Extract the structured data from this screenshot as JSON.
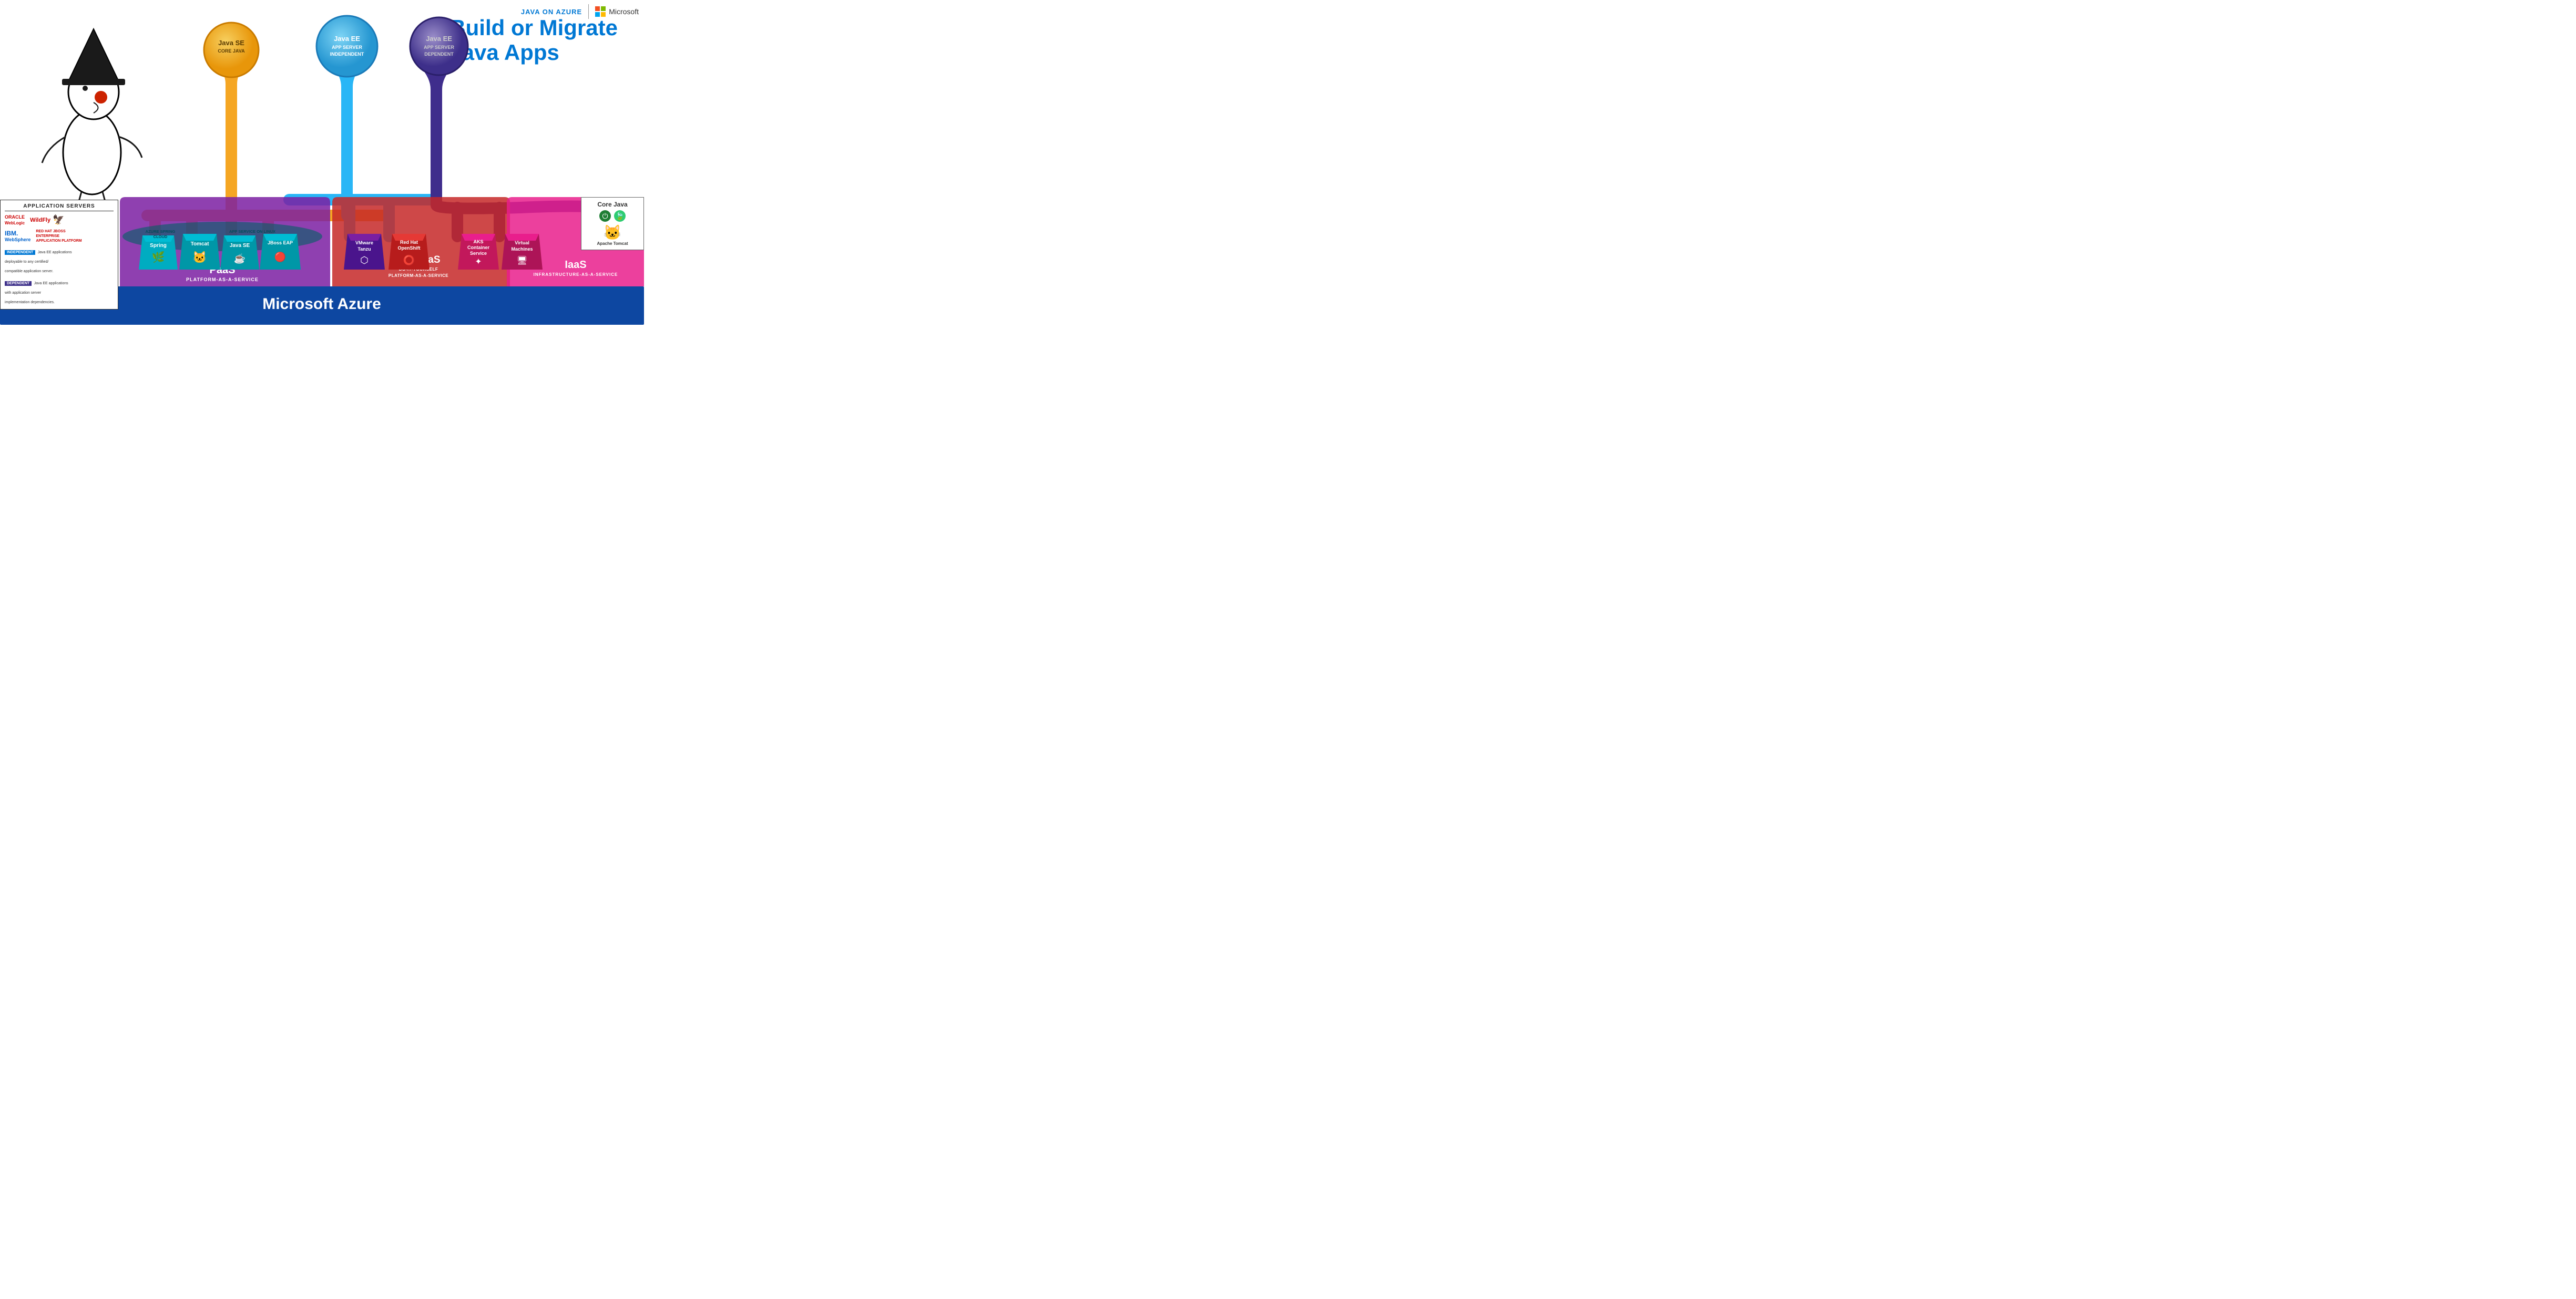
{
  "header": {
    "java_on_azure": "JAVA ON AZURE",
    "microsoft": "Microsoft"
  },
  "hero": {
    "line1": "Build or Migrate",
    "line2": "Java Apps"
  },
  "circles": {
    "java_se": {
      "title": "Java SE",
      "subtitle": "CORE JAVA"
    },
    "java_ee_ind": {
      "title": "Java EE",
      "sub1": "APP SERVER",
      "sub2": "INDEPENDENT"
    },
    "java_ee_dep": {
      "title": "Java EE",
      "sub1": "APP SERVER",
      "sub2": "DEPENDENT"
    }
  },
  "cups": [
    {
      "name": "Spring",
      "icon": "🍃"
    },
    {
      "name": "Tomcat",
      "icon": "🐱"
    },
    {
      "name": "Java SE",
      "icon": "☕"
    },
    {
      "name": "JBoss EAP",
      "icon": "🔴"
    },
    {
      "name": "VMware\nTanzu",
      "icon": "⬡"
    },
    {
      "name": "Red Hat\nOpenShift",
      "icon": "⭕"
    },
    {
      "name": "AKS\nContainer\nService",
      "icon": "✦"
    },
    {
      "name": "Virtual\nMachines",
      "icon": "🖥"
    }
  ],
  "sections": {
    "paas": {
      "title": "PaaS",
      "subtitle": "PLATFORM-AS-A-SERVICE",
      "sublabel1": "AZURE  SPRING",
      "sublabel2": "CLOUD",
      "sublabel3": "APP SERVICE ON LINUX"
    },
    "diy": {
      "title": "DIY PaaS",
      "sub1": "DO-IT-YOURSELF",
      "sub2": "PLATFORM-AS-A-SERVICE"
    },
    "iaas": {
      "title": "IaaS",
      "subtitle": "INFRASTRUCTURE-AS-A-SERVICE"
    },
    "azure": {
      "title": "Microsoft Azure"
    }
  },
  "app_servers": {
    "title": "APPLICATION SERVERS",
    "oracle_line1": "ORACLE",
    "oracle_line2": "WebLogic",
    "wildfly": "WildFly",
    "ibm_line1": "IBM.",
    "ibm_line2": "WebSphere",
    "redhat": "RED HAT JBOSS\nENTERPRISE\nAPPLICATION PLATFORM",
    "independent_badge": "INDEPENDENT",
    "independent_text": "Java EE applications\ndeployable to any certified/\ncompatible application server.",
    "dependent_badge": "DEPENDENT",
    "dependent_text": "Java EE applications\nwith application server\nimplementation dependencies."
  },
  "core_java": {
    "title": "Core Java",
    "tomcat_label": "Apache\nTomcat"
  }
}
